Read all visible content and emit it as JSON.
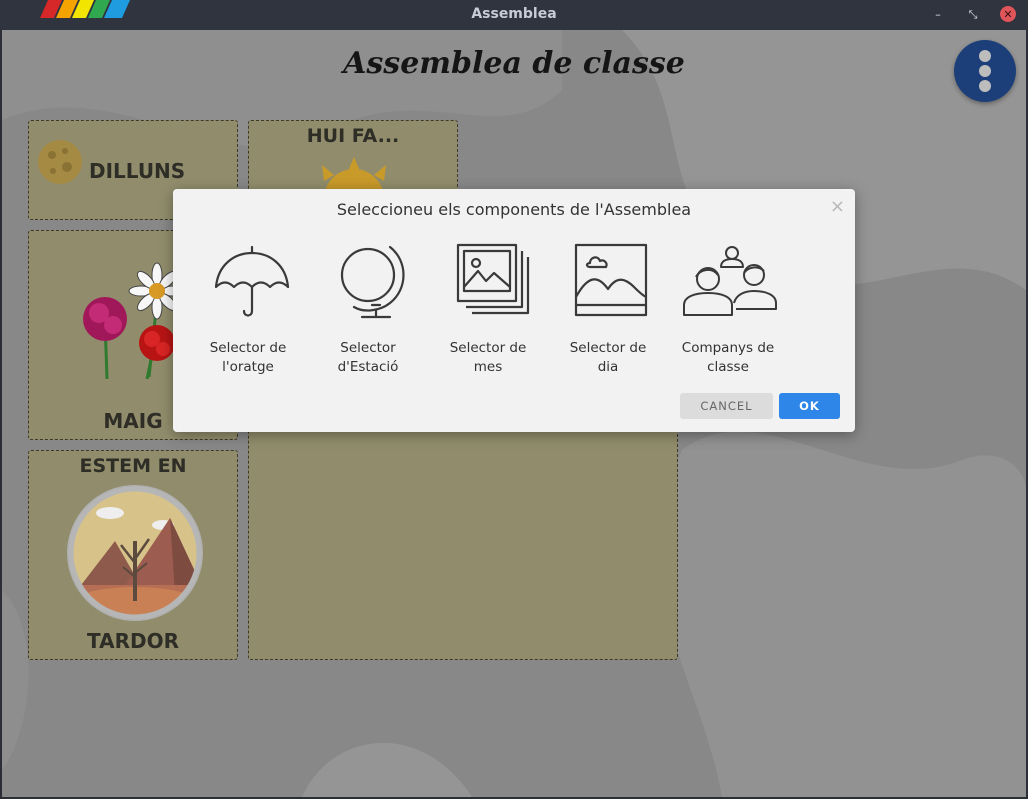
{
  "window": {
    "title": "Assemblea",
    "minimize_glyph": "–",
    "maximize_glyph": "⤡",
    "close_glyph": "✕"
  },
  "app": {
    "title": "Assemblea de classe",
    "menu_icon": "more-vertical-icon"
  },
  "cards": {
    "day": {
      "label": "DILLUNS",
      "icon": "moon-icon"
    },
    "weather": {
      "label": "HUI FA...",
      "icon": "sun-icon"
    },
    "month": {
      "label": "MAIG",
      "icon": "flowers-icon"
    },
    "season": {
      "label_top": "ESTEM EN",
      "label_bottom": "TARDOR",
      "icon": "autumn-landscape-icon"
    }
  },
  "dialog": {
    "title": "Seleccioneu els components de l'Assemblea",
    "close_glyph": "×",
    "options": [
      {
        "line1": "Selector de",
        "line2": "l'oratge",
        "icon": "umbrella-icon"
      },
      {
        "line1": "Selector",
        "line2": "d'Estació",
        "icon": "globe-icon"
      },
      {
        "line1": "Selector de",
        "line2": "mes",
        "icon": "image-stack-icon"
      },
      {
        "line1": "Selector de",
        "line2": "dia",
        "icon": "image-icon"
      },
      {
        "line1": "Companys de",
        "line2": "classe",
        "icon": "people-icon"
      }
    ],
    "cancel_label": "CANCEL",
    "ok_label": "OK"
  },
  "colors": {
    "titlebar": "#2f343f",
    "background": "#888888",
    "card": "#918d6c",
    "dialog": "#f2f2f2",
    "accent": "#2e86e8",
    "fab": "#1c3f7a"
  }
}
